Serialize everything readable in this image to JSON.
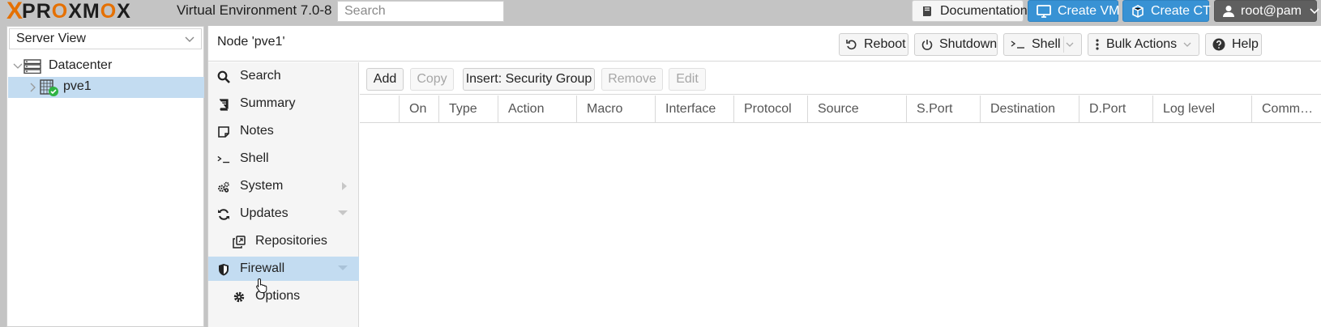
{
  "header": {
    "logo_x": "X",
    "logo_text_a": "PR",
    "logo_text_o": "O",
    "logo_text_b": "XM",
    "logo_text_c": "O",
    "logo_text_d": "X",
    "version": "Virtual Environment 7.0-8",
    "search_placeholder": "Search",
    "buttons": {
      "documentation": "Documentation",
      "create_vm": "Create VM",
      "create_ct": "Create CT",
      "user": "root@pam"
    }
  },
  "tree": {
    "view_label": "Server View",
    "datacenter": "Datacenter",
    "node": "pve1"
  },
  "content": {
    "title": "Node 'pve1'",
    "toolbar": {
      "reboot": "Reboot",
      "shutdown": "Shutdown",
      "shell": "Shell",
      "bulk_actions": "Bulk Actions",
      "help": "Help"
    }
  },
  "nav": {
    "items": [
      {
        "label": "Search",
        "icon": "search-icon"
      },
      {
        "label": "Summary",
        "icon": "book-icon"
      },
      {
        "label": "Notes",
        "icon": "note-icon"
      },
      {
        "label": "Shell",
        "icon": "terminal-icon"
      },
      {
        "label": "System",
        "icon": "gears-icon"
      },
      {
        "label": "Updates",
        "icon": "refresh-icon"
      },
      {
        "label": "Repositories",
        "icon": "files-icon"
      },
      {
        "label": "Firewall",
        "icon": "shield-icon"
      },
      {
        "label": "Options",
        "icon": "gear-icon"
      }
    ]
  },
  "firewall": {
    "toolbar": {
      "add": "Add",
      "copy": "Copy",
      "insert_security_group": "Insert: Security Group",
      "remove": "Remove",
      "edit": "Edit"
    },
    "columns": [
      "On",
      "Type",
      "Action",
      "Macro",
      "Interface",
      "Protocol",
      "Source",
      "S.Port",
      "Destination",
      "D.Port",
      "Log level",
      "Comm…"
    ]
  },
  "colors": {
    "accent": "#3892d4",
    "brand_orange": "#e57000",
    "selection": "#c3dcf1",
    "running_status": "#2fb344"
  }
}
